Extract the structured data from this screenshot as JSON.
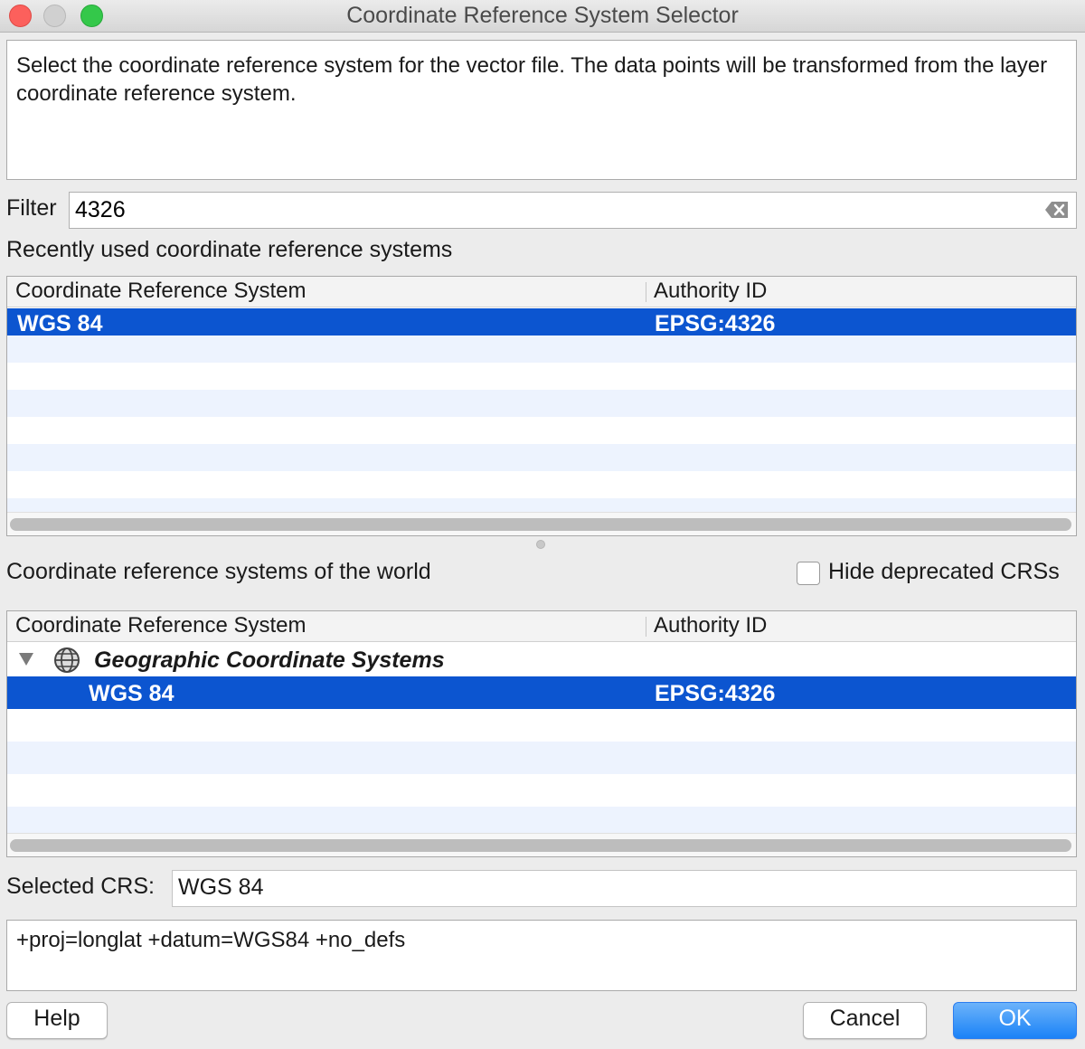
{
  "window": {
    "title": "Coordinate Reference System Selector"
  },
  "description": "Select the coordinate reference system for the vector file. The data points will be transformed from the layer coordinate reference system.",
  "filter": {
    "label": "Filter",
    "value": "4326"
  },
  "recent": {
    "section_label": "Recently used coordinate reference systems",
    "columns": [
      "Coordinate Reference System",
      "Authority ID"
    ],
    "rows": [
      {
        "name": "WGS 84",
        "authority": "EPSG:4326",
        "selected": true
      }
    ]
  },
  "world": {
    "section_label": "Coordinate reference systems of the world",
    "hide_deprecated_label": "Hide deprecated CRSs",
    "hide_deprecated_checked": false,
    "columns": [
      "Coordinate Reference System",
      "Authority ID"
    ],
    "group": {
      "label": "Geographic Coordinate Systems",
      "expanded": true,
      "icon": "globe-icon",
      "children": [
        {
          "name": "WGS 84",
          "authority": "EPSG:4326",
          "selected": true
        }
      ]
    }
  },
  "selected_crs": {
    "label": "Selected CRS:",
    "value": "WGS 84"
  },
  "proj_string": "+proj=longlat +datum=WGS84 +no_defs",
  "buttons": {
    "help": "Help",
    "cancel": "Cancel",
    "ok": "OK"
  },
  "colors": {
    "selection": "#0c55d0",
    "stripe": "#edf3fe",
    "ok_button": "#1a82f7"
  }
}
